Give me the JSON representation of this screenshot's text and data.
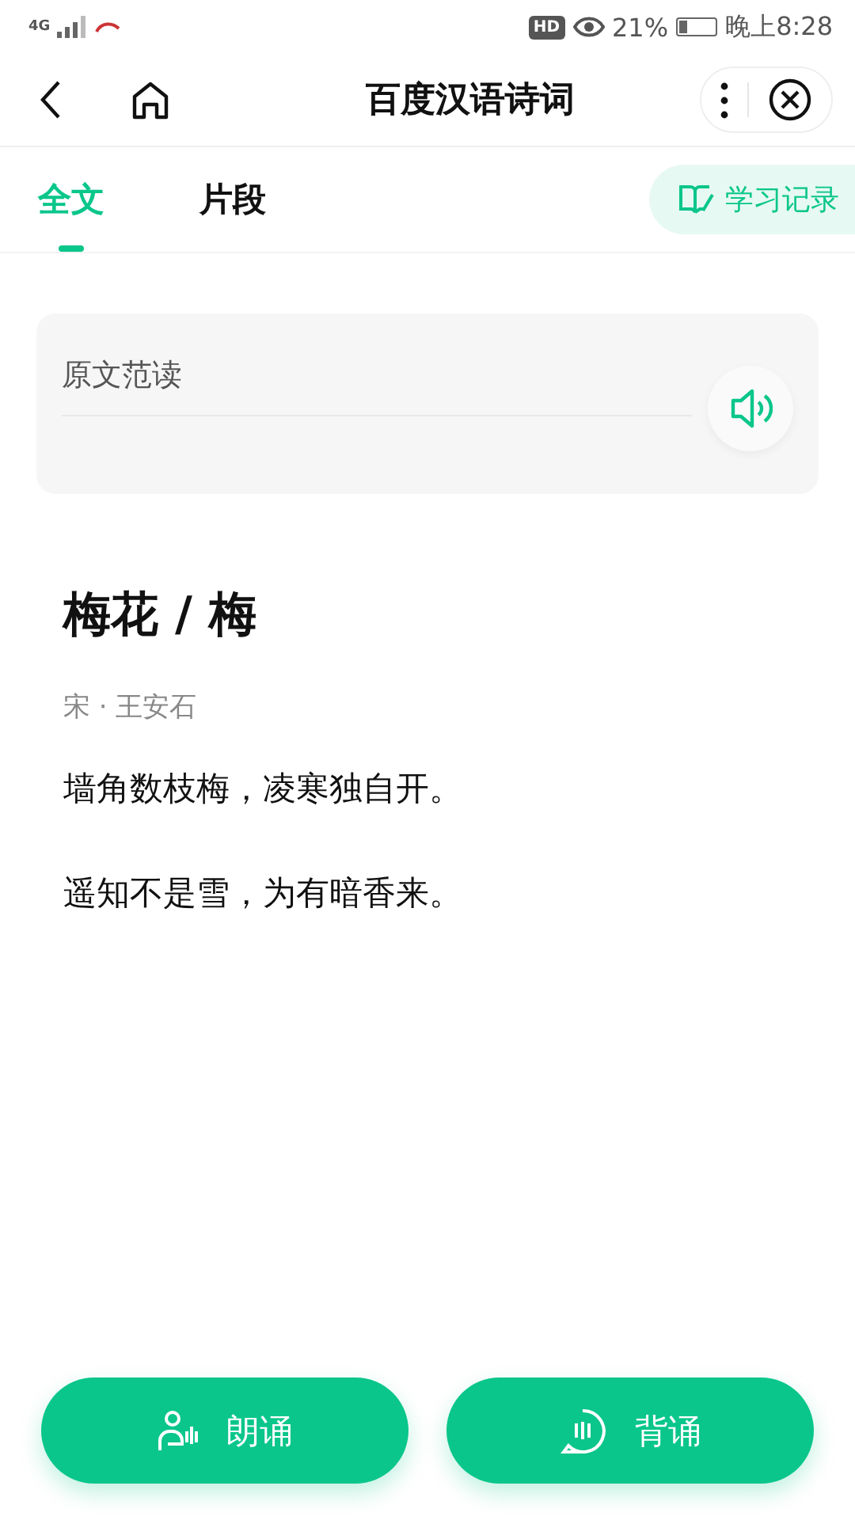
{
  "status_bar": {
    "network": "4G",
    "hd_badge": "HD",
    "battery_text": "21%",
    "time": "晚上8:28"
  },
  "nav": {
    "title": "百度汉语诗词"
  },
  "tabs": [
    {
      "label": "全文",
      "selected": true
    },
    {
      "label": "片段",
      "selected": false
    }
  ],
  "history_button": {
    "label": "学习记录"
  },
  "audio_card": {
    "label": "原文范读"
  },
  "poem": {
    "title": "梅花 / 梅",
    "author": "宋 · 王安石",
    "lines": [
      "墙角数枝梅，凌寒独自开。",
      "遥知不是雪，为有暗香来。"
    ]
  },
  "actions": [
    {
      "label": "朗诵",
      "kind": "read"
    },
    {
      "label": "背诵",
      "kind": "recite"
    }
  ]
}
